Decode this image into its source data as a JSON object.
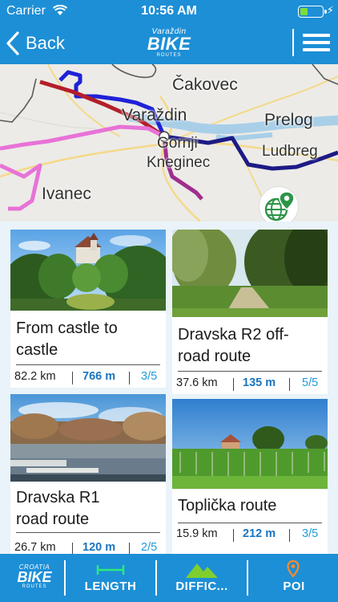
{
  "status_bar": {
    "carrier": "Carrier",
    "time": "10:56 AM"
  },
  "nav": {
    "back_label": "Back",
    "logo": {
      "line1": "Varaždin",
      "line2": "BIKE",
      "line3": "ROUTES"
    }
  },
  "map": {
    "labels": {
      "cakovec": "Čakovec",
      "varazdin": "Varaždin",
      "prelog": "Prelog",
      "gornji": "Gornji",
      "kneginec": "Kneginec",
      "ludbreg": "Ludbreg",
      "ivanec": "Ivanec"
    },
    "colors": {
      "blue_route": "#1f22d6",
      "navy_route": "#1c1a86",
      "red_route": "#b41e2a",
      "magenta_route": "#e872d8",
      "purple_route": "#9f2e8d",
      "river": "#a9cfe8"
    }
  },
  "routes": [
    {
      "title": "From castle to castle",
      "length": "82.2 km",
      "elevation": "766 m",
      "difficulty": "3/5"
    },
    {
      "title": "Dravska R2 off-road route",
      "length": "37.6 km",
      "elevation": "135 m",
      "difficulty": "5/5"
    },
    {
      "title": "Dravska R1 road route",
      "length": "26.7 km",
      "elevation": "120 m",
      "difficulty": "2/5"
    },
    {
      "title": "Toplička route",
      "length": "15.9 km",
      "elevation": "212 m",
      "difficulty": "3/5"
    }
  ],
  "toolbar": {
    "logo": {
      "line1": "CROATIA",
      "line2": "BIKE",
      "line3": "ROUTES"
    },
    "length_label": "LENGTH",
    "difficulty_label": "DIFFIC...",
    "poi_label": "POI"
  },
  "theme": {
    "primary": "#1d8fd6",
    "elevation_text": "#1a74c0",
    "difficulty_text": "#1d9cd8",
    "grid_bg": "#e9f3f9"
  }
}
